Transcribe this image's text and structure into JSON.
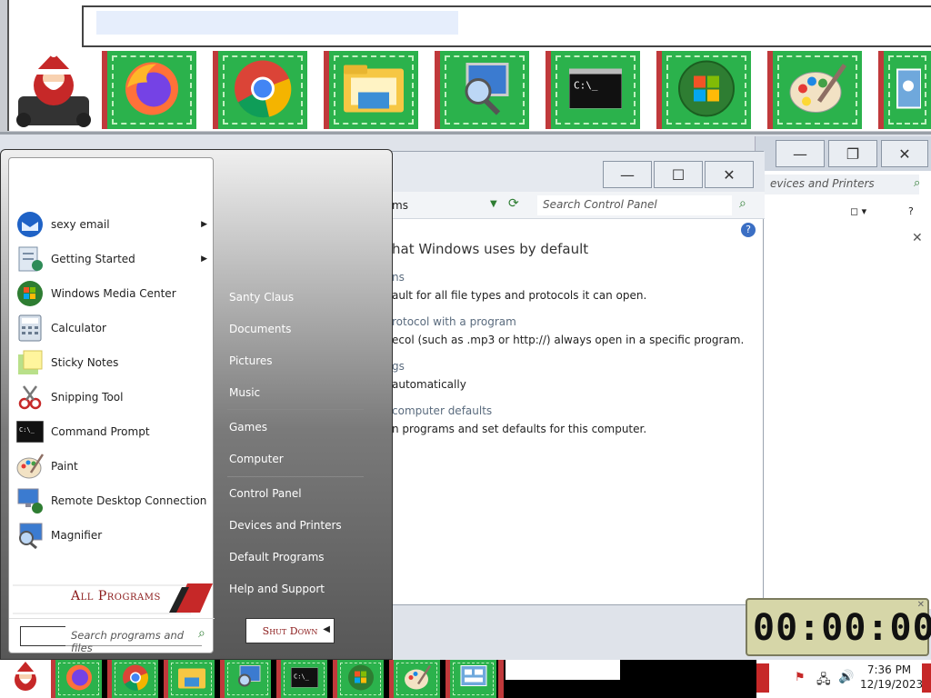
{
  "dock": {
    "items": [
      {
        "name": "Firefox",
        "icon": "firefox-icon"
      },
      {
        "name": "Chrome",
        "icon": "chrome-icon"
      },
      {
        "name": "File Explorer",
        "icon": "file-explorer-icon"
      },
      {
        "name": "Network Search",
        "icon": "network-search-icon"
      },
      {
        "name": "Command Prompt",
        "icon": "command-prompt-icon"
      },
      {
        "name": "Windows Media Center",
        "icon": "windows-orb-icon"
      },
      {
        "name": "Paint",
        "icon": "paint-icon"
      },
      {
        "name": "Control Panel",
        "icon": "control-panel-icon"
      }
    ]
  },
  "control_panel": {
    "breadcrumb": "ms",
    "search_placeholder": "Search Control Panel",
    "heading": "hat Windows uses by default",
    "sections": [
      {
        "title": "ns",
        "desc": "ault for all file types and protocols it can open."
      },
      {
        "title": "rotocol with a program",
        "desc": "ecol (such as .mp3 or http://) always open in a specific program."
      },
      {
        "title": "gs",
        "desc": "automatically"
      },
      {
        "title": " computer defaults",
        "desc": "n programs and set defaults for this computer."
      }
    ]
  },
  "bg_window": {
    "search_placeholder": "evices and Printers",
    "help": "?"
  },
  "start_menu": {
    "programs": [
      {
        "label": "sexy email",
        "icon": "thunderbird-icon",
        "submenu": true
      },
      {
        "label": "Getting Started",
        "icon": "getting-started-icon",
        "submenu": true
      },
      {
        "label": "Windows Media Center",
        "icon": "windows-media-center-icon",
        "submenu": false
      },
      {
        "label": "Calculator",
        "icon": "calculator-icon",
        "submenu": false
      },
      {
        "label": "Sticky Notes",
        "icon": "sticky-notes-icon",
        "submenu": false
      },
      {
        "label": "Snipping Tool",
        "icon": "snipping-tool-icon",
        "submenu": false
      },
      {
        "label": "Command Prompt",
        "icon": "command-prompt-icon",
        "submenu": false
      },
      {
        "label": "Paint",
        "icon": "paint-icon",
        "submenu": false
      },
      {
        "label": "Remote Desktop Connection",
        "icon": "remote-desktop-icon",
        "submenu": false
      },
      {
        "label": "Magnifier",
        "icon": "magnifier-icon",
        "submenu": false
      }
    ],
    "all_programs": "All Programs",
    "search_placeholder": "Search programs and files",
    "right_items": [
      "Santy Claus",
      "Documents",
      "Pictures",
      "Music",
      "Games",
      "Computer",
      "Control Panel",
      "Devices and Printers",
      "Default Programs",
      "Help and Support"
    ],
    "shutdown": "Shut Down"
  },
  "taskbar": {
    "time": "7:36 PM",
    "date": "12/19/2023"
  },
  "timer": {
    "display": "00:00:00"
  },
  "colors": {
    "dock_green": "#2bb24c",
    "dock_red": "#c0393b",
    "link": "#5a6b7e"
  }
}
